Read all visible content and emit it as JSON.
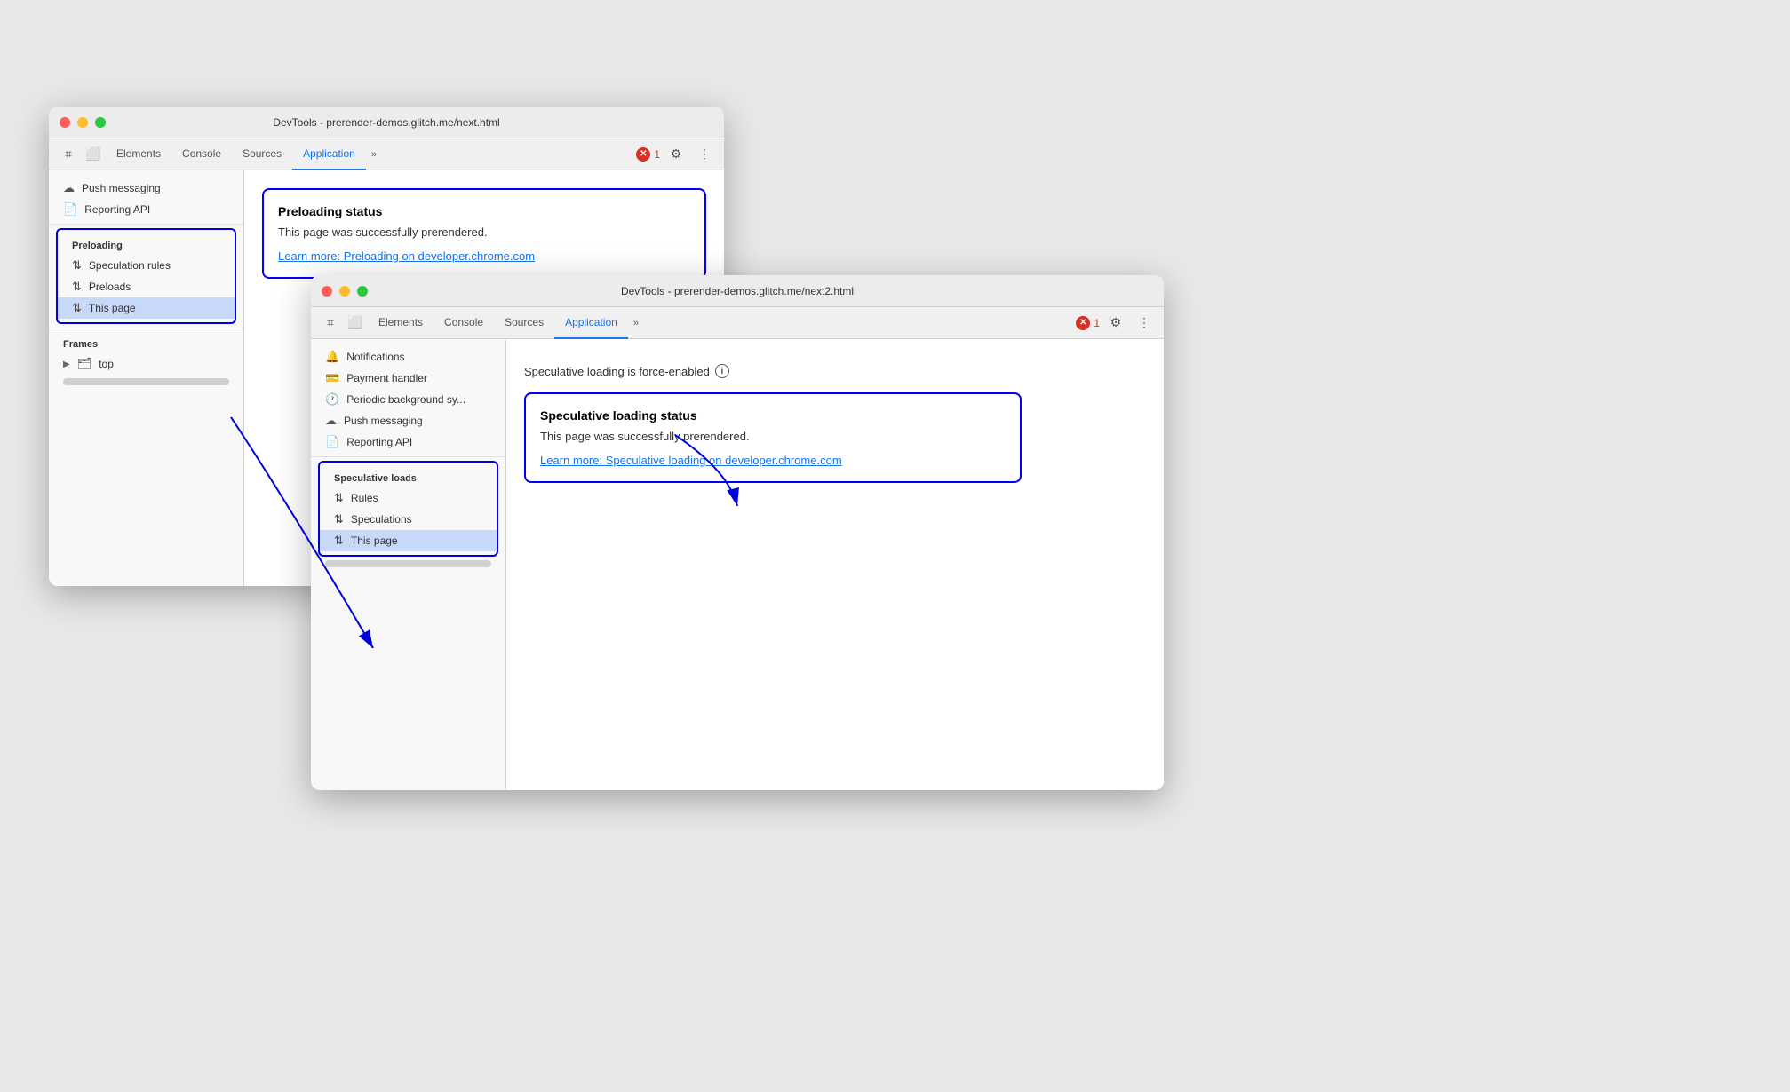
{
  "window1": {
    "title": "DevTools - prerender-demos.glitch.me/next.html",
    "tabs": [
      "Elements",
      "Console",
      "Sources",
      "Application"
    ],
    "activeTab": "Application",
    "errorCount": "1",
    "sidebar": {
      "sections": [
        {
          "label": "",
          "items": [
            {
              "icon": "cloud",
              "label": "Push messaging"
            },
            {
              "icon": "doc",
              "label": "Reporting API"
            }
          ]
        },
        {
          "label": "Preloading",
          "items": [
            {
              "icon": "arrows",
              "label": "Speculation rules"
            },
            {
              "icon": "arrows",
              "label": "Preloads"
            },
            {
              "icon": "arrows",
              "label": "This page",
              "selected": true
            }
          ]
        },
        {
          "label": "Frames",
          "items": [
            {
              "icon": "folder",
              "label": "top",
              "tree": true
            }
          ]
        }
      ]
    },
    "main": {
      "statusBox": {
        "title": "Preloading status",
        "text": "This page was successfully prerendered.",
        "link": "Learn more: Preloading on developer.chrome.com"
      }
    }
  },
  "window2": {
    "title": "DevTools - prerender-demos.glitch.me/next2.html",
    "tabs": [
      "Elements",
      "Console",
      "Sources",
      "Application"
    ],
    "activeTab": "Application",
    "errorCount": "1",
    "sidebar": {
      "items": [
        {
          "icon": "bell",
          "label": "Notifications"
        },
        {
          "icon": "card",
          "label": "Payment handler"
        },
        {
          "icon": "clock",
          "label": "Periodic background sy..."
        },
        {
          "icon": "cloud",
          "label": "Push messaging"
        },
        {
          "icon": "doc",
          "label": "Reporting API"
        }
      ],
      "speculativeSection": {
        "label": "Speculative loads",
        "items": [
          {
            "icon": "arrows",
            "label": "Rules"
          },
          {
            "icon": "arrows",
            "label": "Speculations"
          },
          {
            "icon": "arrows",
            "label": "This page",
            "selected": true
          }
        ]
      }
    },
    "main": {
      "forceEnabled": "Speculative loading is force-enabled",
      "statusBox": {
        "title": "Speculative loading status",
        "text": "This page was successfully prerendered.",
        "link": "Learn more: Speculative loading on developer.chrome.com"
      }
    }
  },
  "icons": {
    "cursor": "⌗",
    "device": "⬜",
    "arrows_updown": "⇅",
    "gear": "⚙",
    "more": "⋮",
    "more_tabs": "»",
    "close_x": "✕",
    "cloud": "☁",
    "doc": "📄",
    "bell": "🔔",
    "card": "💳",
    "clock": "🕐",
    "folder": "▶"
  }
}
